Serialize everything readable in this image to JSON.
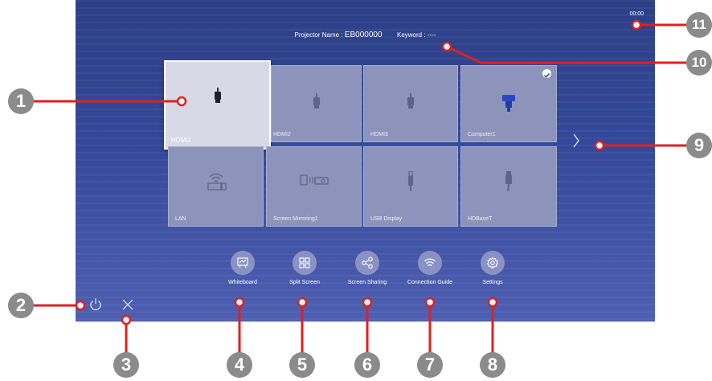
{
  "header": {
    "clock": "00:00",
    "projector_name_label": "Projector Name :",
    "projector_name": "EB000000",
    "keyword_label": "Keyword :",
    "keyword": "----"
  },
  "sources": [
    {
      "label": "HDMI1",
      "icon": "hdmi-icon",
      "active": true
    },
    {
      "label": "HDMI2",
      "icon": "hdmi-icon"
    },
    {
      "label": "HDMI3",
      "icon": "hdmi-icon"
    },
    {
      "label": "Computer1",
      "icon": "vga-icon",
      "connected": true
    },
    {
      "label": "LAN",
      "icon": "lan-icon"
    },
    {
      "label": "Screen Mirroring1",
      "icon": "screen-mirroring-icon"
    },
    {
      "label": "USB Display",
      "icon": "usb-icon"
    },
    {
      "label": "HDBaseT",
      "icon": "hdbaset-icon"
    }
  ],
  "functions": [
    {
      "label": "Whiteboard",
      "icon": "whiteboard-icon"
    },
    {
      "label": "Split Screen",
      "icon": "split-screen-icon"
    },
    {
      "label": "Screen Sharing",
      "icon": "share-icon"
    },
    {
      "label": "Connection Guide",
      "icon": "wifi-icon"
    },
    {
      "label": "Settings",
      "icon": "gear-icon"
    }
  ],
  "controls": {
    "power_icon": "power-icon",
    "close_icon": "close-icon",
    "next_icon": "chevron-right-icon"
  },
  "callouts": [
    "1",
    "2",
    "3",
    "4",
    "5",
    "6",
    "7",
    "8",
    "9",
    "10",
    "11"
  ],
  "colors": {
    "background_top": "#2d3f86",
    "background_bottom": "#4f5fb1",
    "tile": "#8c94bb",
    "tile_active": "#d9d8e6",
    "function_circle": "#8a92c3",
    "callout_line": "#e02020",
    "callout_badge": "#8b8b8b"
  }
}
